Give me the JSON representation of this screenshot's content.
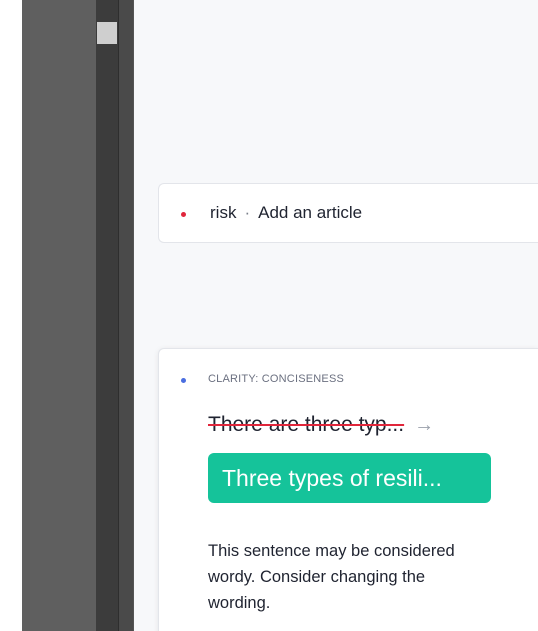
{
  "mini_card": {
    "word": "risk",
    "separator": "·",
    "action": "Add an article"
  },
  "suggestion_card": {
    "category": "CLARITY: CONCISENESS",
    "original": "There are three typ...",
    "replacement": "Three types of resili...",
    "explanation": "This sentence may be considered wordy. Consider changing the wording."
  },
  "colors": {
    "alert_red": "#e0263b",
    "clarity_blue": "#4a6ee0",
    "accept_green": "#15c39a"
  }
}
